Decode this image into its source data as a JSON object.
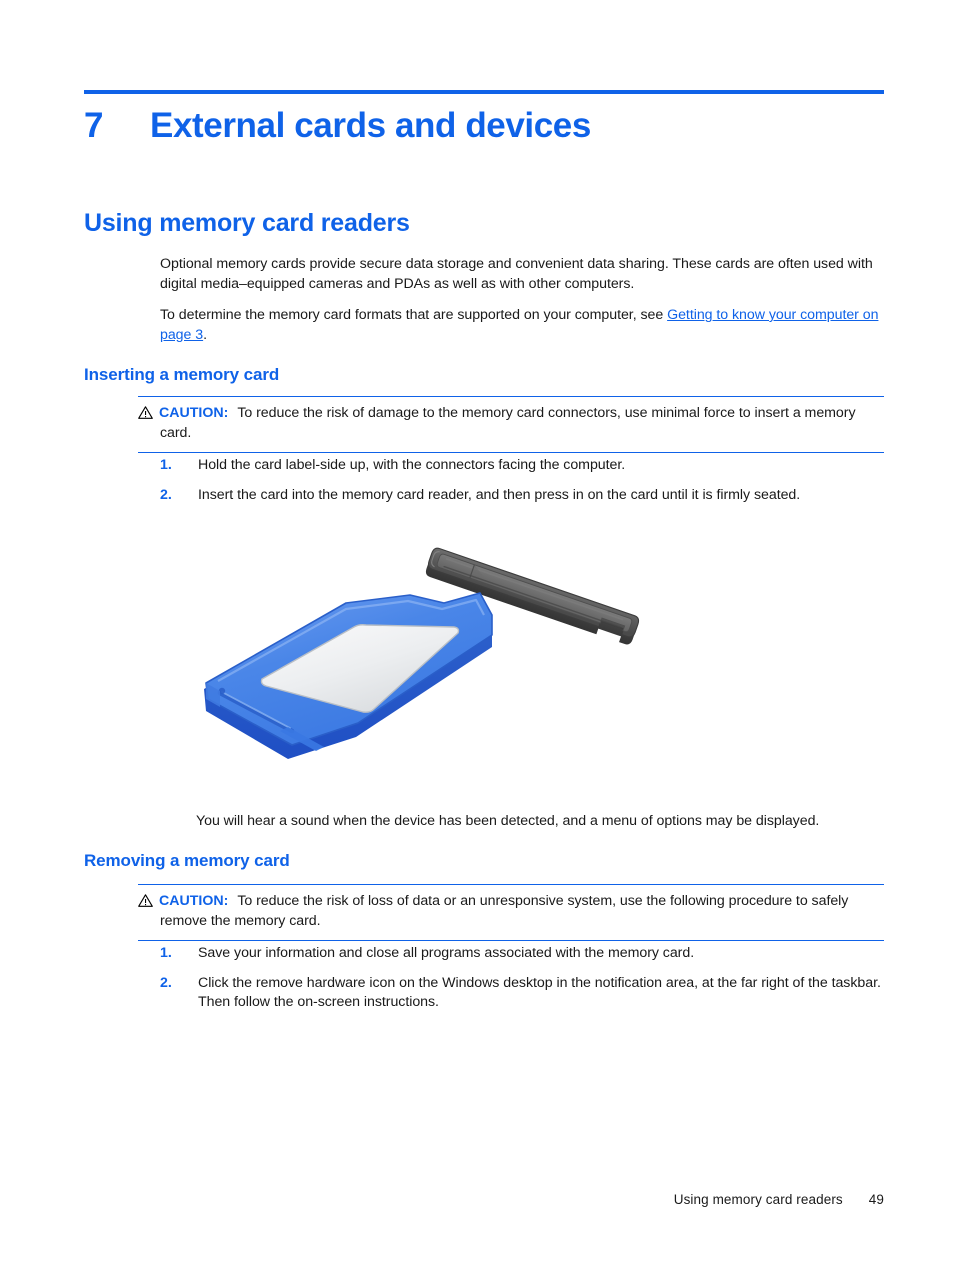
{
  "chapter": {
    "number": "7",
    "title": "External cards and devices"
  },
  "sections": {
    "using_memory_card_readers": "Using memory card readers",
    "inserting_a_memory_card": "Inserting a memory card",
    "removing_a_memory_card": "Removing a memory card"
  },
  "intro": {
    "paragraph1": "Optional memory cards provide secure data storage and convenient data sharing. These cards are often used with digital media–equipped cameras and PDAs as well as with other computers.",
    "paragraph2_before_link": "To determine the memory card formats that are supported on your computer, see ",
    "link_text": "Getting to know your computer on page 3",
    "paragraph2_after_link": "."
  },
  "caution_insert": {
    "label": "CAUTION:",
    "text": "To reduce the risk of damage to the memory card connectors, use minimal force to insert a memory card.",
    "icon": "warning-triangle-icon"
  },
  "insert_steps": [
    {
      "number": "1.",
      "text": "Hold the card label-side up, with the connectors facing the computer."
    },
    {
      "number": "2.",
      "text": "Insert the card into the memory card reader, and then press in on the card until it is firmly seated."
    }
  ],
  "figure": {
    "name": "memory-card-insertion-illustration",
    "card_color": "#4a86e8",
    "card_color_light": "#7aa8f0",
    "card_color_dark": "#1f4fc4",
    "label_color": "#eceef0",
    "reader_color": "#5c5c5c",
    "reader_color_dark": "#3e3e3e",
    "arrow_color": "#000000"
  },
  "figure_caption": "You will hear a sound when the device has been detected, and a menu of options may be displayed.",
  "caution_remove": {
    "label": "CAUTION:",
    "text": "To reduce the risk of loss of data or an unresponsive system, use the following procedure to safely remove the memory card.",
    "icon": "warning-triangle-icon"
  },
  "remove_steps": [
    {
      "number": "1.",
      "text": "Save your information and close all programs associated with the memory card."
    },
    {
      "number": "2.",
      "text": "Click the remove hardware icon on the Windows desktop in the notification area, at the far right of the taskbar. Then follow the on-screen instructions."
    }
  ],
  "footer": {
    "section": "Using memory card readers",
    "page_number": "49"
  },
  "colors": {
    "accent_blue": "#0f62e8",
    "body_text": "#1a1a1a"
  }
}
